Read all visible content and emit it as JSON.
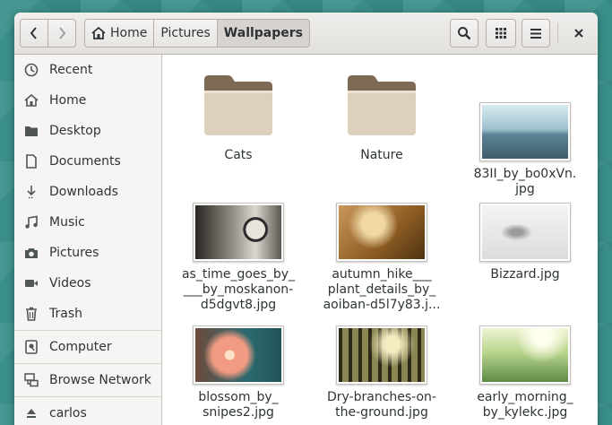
{
  "window": {
    "breadcrumbs": [
      {
        "label": "Home",
        "icon": "home-icon"
      },
      {
        "label": "Pictures"
      },
      {
        "label": "Wallpapers",
        "active": true
      }
    ]
  },
  "sidebar": {
    "items": [
      {
        "label": "Recent",
        "icon": "clock-icon"
      },
      {
        "label": "Home",
        "icon": "home-icon"
      },
      {
        "label": "Desktop",
        "icon": "folder-icon"
      },
      {
        "label": "Documents",
        "icon": "document-icon"
      },
      {
        "label": "Downloads",
        "icon": "download-icon"
      },
      {
        "label": "Music",
        "icon": "music-icon"
      },
      {
        "label": "Pictures",
        "icon": "camera-icon"
      },
      {
        "label": "Videos",
        "icon": "video-icon"
      },
      {
        "label": "Trash",
        "icon": "trash-icon"
      },
      {
        "label": "Computer",
        "icon": "drive-icon"
      },
      {
        "label": "Browse Network",
        "icon": "network-icon"
      },
      {
        "label": "carlos",
        "icon": "eject-icon"
      }
    ]
  },
  "files": [
    {
      "name": "Cats",
      "type": "folder"
    },
    {
      "name": "Nature",
      "type": "folder"
    },
    {
      "name_lines": [
        "83II_by_bo0xVn.",
        "jpg"
      ],
      "type": "image",
      "colors": [
        "#cfe4ea",
        "#7aa2b4",
        "#3c5968"
      ]
    },
    {
      "name_lines": [
        "as_time_goes_by_",
        "___by_moskanon-",
        "d5dgvt8.jpg"
      ],
      "type": "image",
      "colors": [
        "#d8d4cc",
        "#6f6a62",
        "#222"
      ]
    },
    {
      "name_lines": [
        "autumn_hike___",
        "plant_details_by_",
        "aoiban-d5l7y83.j..."
      ],
      "type": "image",
      "colors": [
        "#e2c08a",
        "#a8742f",
        "#5a3a15"
      ]
    },
    {
      "name_lines": [
        "Bizzard.jpg"
      ],
      "type": "image",
      "colors": [
        "#f2f2f2",
        "#d9d9d9",
        "#8a8a8a"
      ]
    },
    {
      "name_lines": [
        "blossom_by_",
        "snipes2.jpg"
      ],
      "type": "image",
      "colors": [
        "#2e6e73",
        "#f0a58c",
        "#f6d3b8"
      ]
    },
    {
      "name_lines": [
        "Dry-branches-on-",
        "the-ground.jpg"
      ],
      "type": "image",
      "colors": [
        "#e6dcb0",
        "#6d7040",
        "#2b2a18"
      ]
    },
    {
      "name_lines": [
        "early_morning_",
        "by_kylekc.jpg"
      ],
      "type": "image",
      "colors": [
        "#f3f6d8",
        "#a6c77a",
        "#4f7a3c"
      ]
    }
  ],
  "colors": {
    "accent": "#3a8f8a"
  }
}
